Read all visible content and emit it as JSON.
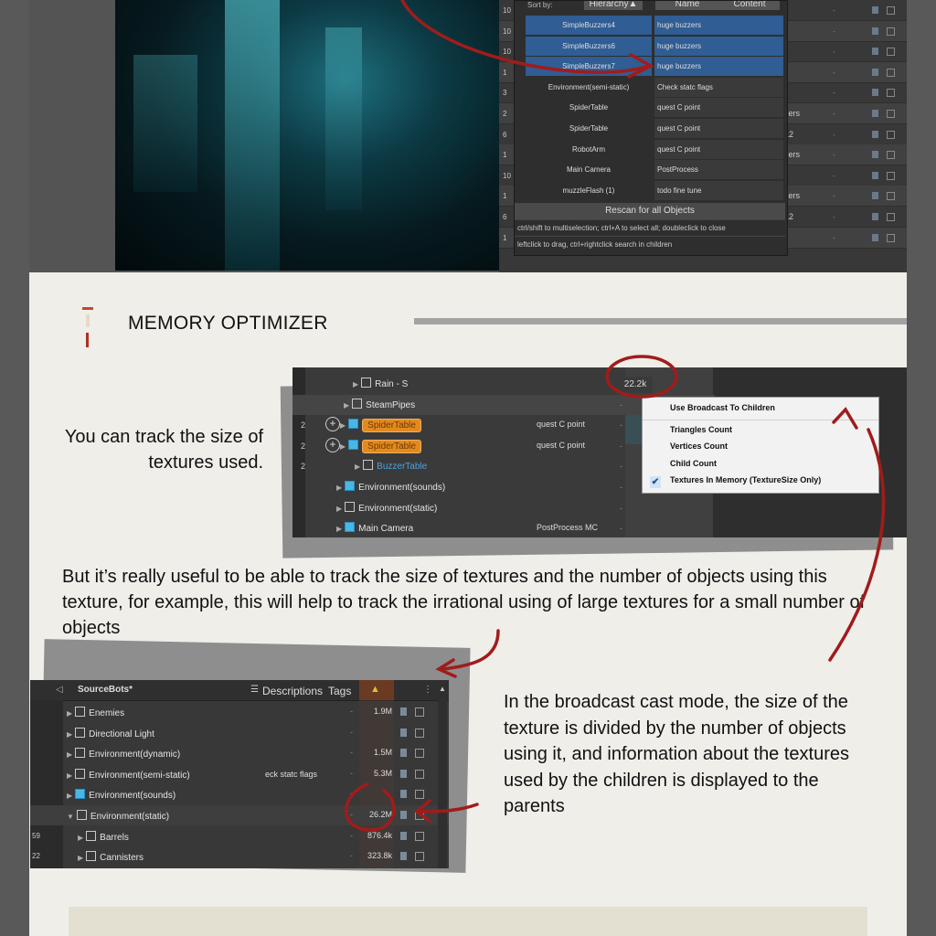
{
  "hierarchy_top": {
    "sort_by_label": "Sort by:",
    "columns": [
      "Hierarchy▲",
      "Name",
      "Content"
    ],
    "row_numbers": [
      "10",
      "10",
      "10",
      "1",
      "3",
      "2",
      "6",
      "1",
      "10",
      "1",
      "6",
      "1"
    ],
    "row_extras": [
      "",
      "",
      "",
      "",
      "",
      "zers",
      "12",
      "zers",
      "",
      "zers",
      "12",
      ""
    ],
    "popup_rows": [
      {
        "name": "SimpleBuzzers4",
        "desc": "huge buzzers",
        "selected": true
      },
      {
        "name": "SimpleBuzzers6",
        "desc": "huge buzzers",
        "selected": true
      },
      {
        "name": "SimpleBuzzers7",
        "desc": "huge buzzers",
        "selected": true
      },
      {
        "name": "Environment(semi-static)",
        "desc": "Check statc flags",
        "selected": false
      },
      {
        "name": "SpiderTable",
        "desc": "quest C point",
        "selected": false
      },
      {
        "name": "SpiderTable",
        "desc": "quest C point",
        "selected": false
      },
      {
        "name": "RobotArm",
        "desc": "quest C point",
        "selected": false
      },
      {
        "name": "Main Camera",
        "desc": "PostProcess",
        "selected": false
      },
      {
        "name": "muzzleFlash (1)",
        "desc": "todo fine tune",
        "selected": false
      }
    ],
    "rescan_label": "Rescan for all Objects",
    "hint1": "ctrl/shift to multiselection; ctrl+A to select all; doubleclick to close",
    "hint2": "leftclick to drag, ctrl+rightclick search in children"
  },
  "section_title": "MEMORY OPTIMIZER",
  "text1": "You can track the size of textures used.",
  "text2": "But it’s really useful to be able to track the size of textures and the number of objects using this texture, for example, this will help to track the irrational using of large textures for a small number of objects",
  "text3": "In the broadcast cast mode, the size of the texture is divided by the number of objects using it, and information about the textures used by the children is displayed to the parents",
  "shot2": {
    "rows": [
      {
        "num": "",
        "name": "Rain - S",
        "desc": ""
      },
      {
        "num": "",
        "name": "SteamPipes",
        "desc": ""
      },
      {
        "num": "2",
        "name": "SpiderTable",
        "desc": "quest C point"
      },
      {
        "num": "2",
        "name": "SpiderTable",
        "desc": "quest C point"
      },
      {
        "num": "2",
        "name": "BuzzerTable",
        "desc": ""
      },
      {
        "num": "",
        "name": "Environment(sounds)",
        "desc": ""
      },
      {
        "num": "",
        "name": "Environment(static)",
        "desc": ""
      },
      {
        "num": "",
        "name": "Main Camera",
        "desc": "PostProcess MC"
      }
    ],
    "size_value": "22.2k",
    "menu_items": [
      "Use Broadcast To Children",
      "Triangles Count",
      "Vertices Count",
      "Child Count",
      "Textures In Memory (TextureSize Only)"
    ],
    "menu_checked_index": 4
  },
  "shot3": {
    "title": "SourceBots*",
    "col_descriptions": "Descriptions",
    "col_tags": "Tags",
    "rows": [
      {
        "num": "",
        "name": "Enemies",
        "desc": "",
        "size": "1.9M"
      },
      {
        "num": "",
        "name": "Directional Light",
        "desc": "",
        "size": ""
      },
      {
        "num": "",
        "name": "Environment(dynamic)",
        "desc": "",
        "size": "1.5M"
      },
      {
        "num": "",
        "name": "Environment(semi-static)",
        "desc": "eck statc flags",
        "size": "5.3M"
      },
      {
        "num": "",
        "name": "Environment(sounds)",
        "desc": "",
        "size": ""
      },
      {
        "num": "",
        "name": "Environment(static)",
        "desc": "",
        "size": "26.2M"
      },
      {
        "num": "59",
        "name": "Barrels",
        "desc": "",
        "size": "876.4k"
      },
      {
        "num": "22",
        "name": "Cannisters",
        "desc": "",
        "size": "323.8k"
      }
    ]
  },
  "colors": {
    "accent_red": "#a01c1c",
    "selection_blue": "#2f5d94",
    "chip_orange": "#e38a1f"
  }
}
